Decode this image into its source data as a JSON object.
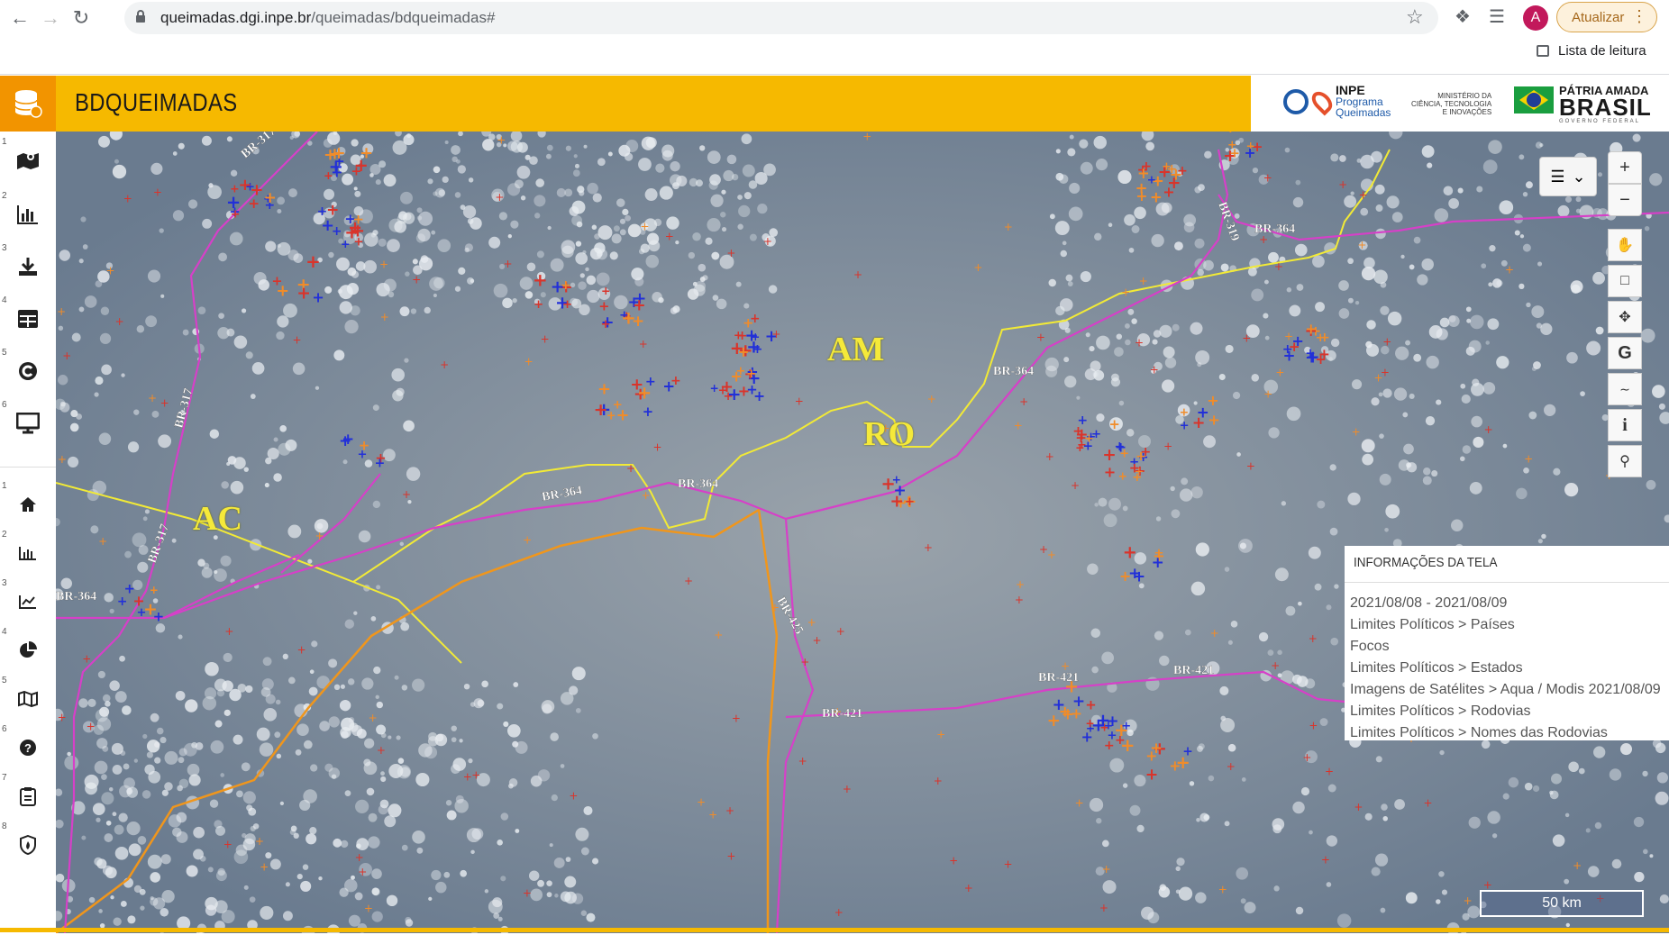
{
  "browser": {
    "url_host": "queimadas.dgi.inpe.br",
    "url_path": "/queimadas/bdqueimadas#",
    "avatar_letter": "A",
    "update_label": "Atualizar",
    "reading_list_label": "Lista de leitura"
  },
  "app": {
    "title": "BDQUEIMADAS",
    "brand": {
      "inpe": "INPE",
      "inpe_sub1": "Programa",
      "inpe_sub2": "Queimadas",
      "ministry_line1": "MINISTÉRIO DA",
      "ministry_line2": "CIÊNCIA, TECNOLOGIA",
      "ministry_line3": "E INOVAÇÕES",
      "patria": "PÁTRIA AMADA",
      "brasil": "BRASIL",
      "gov": "GOVERNO FEDERAL"
    },
    "accent_color": "#f6b900"
  },
  "sidebar": {
    "top_items": [
      {
        "num": "1",
        "icon": "map-marker-icon"
      },
      {
        "num": "2",
        "icon": "bar-chart-icon"
      },
      {
        "num": "3",
        "icon": "download-icon"
      },
      {
        "num": "4",
        "icon": "table-icon"
      },
      {
        "num": "5",
        "icon": "refresh-icon"
      },
      {
        "num": "6",
        "icon": "monitor-icon"
      }
    ],
    "bottom_items": [
      {
        "num": "1",
        "icon": "home-icon"
      },
      {
        "num": "2",
        "icon": "bar-chart-small-icon"
      },
      {
        "num": "3",
        "icon": "line-chart-icon"
      },
      {
        "num": "4",
        "icon": "pie-chart-icon"
      },
      {
        "num": "5",
        "icon": "map-icon"
      },
      {
        "num": "6",
        "icon": "help-icon"
      },
      {
        "num": "7",
        "icon": "clipboard-icon"
      },
      {
        "num": "8",
        "icon": "fire-shield-icon"
      }
    ]
  },
  "map": {
    "state_labels": [
      "AM",
      "RO",
      "AC"
    ],
    "road_labels": [
      "BR-317",
      "BR-364",
      "BR-421",
      "BR-425",
      "BR-319"
    ],
    "scale_label": "50 km",
    "controls": [
      "zoom-in",
      "zoom-out",
      "pan",
      "crop",
      "move",
      "google",
      "graph",
      "info",
      "zoom-box"
    ],
    "zoom_in": "+",
    "zoom_out": "−",
    "info_glyph": "i",
    "google_glyph": "G"
  },
  "info_panel": {
    "title": "INFORMAÇÕES DA TELA",
    "items": [
      "2021/08/08 - 2021/08/09",
      "Limites Políticos > Países",
      "Focos",
      "Limites Políticos > Estados",
      "Imagens de Satélites > Aqua / Modis 2021/08/09",
      "Limites Políticos > Rodovias",
      "Limites Políticos > Nomes das Rodovias"
    ]
  }
}
